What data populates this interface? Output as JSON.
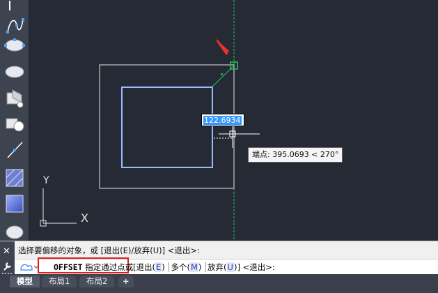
{
  "canvas": {
    "dynamic_input_value": "122.6934",
    "tooltip_text": "端点: 395.0693 < 270°",
    "ucs_y_label": "Y",
    "ucs_x_label": "X"
  },
  "command": {
    "history_line": "选择要偏移的对象，或 [退出(E)/放弃(U)] <退出>:",
    "command_name": "OFFSET",
    "prompt_text": "指定通过点或",
    "options_open": "[",
    "option_exit": "退出",
    "option_exit_key": "E",
    "option_multiple": "多个",
    "option_multiple_key": "M",
    "option_undo": "放弃",
    "option_undo_key": "U",
    "options_close": "]",
    "default_value": "<退出>:"
  },
  "tabs": [
    {
      "label": "模型",
      "active": true
    },
    {
      "label": "布局1",
      "active": false
    },
    {
      "label": "布局2",
      "active": false
    },
    {
      "label": "+",
      "active": false
    }
  ],
  "colors": {
    "canvas_bg": "#262a34",
    "selected_rect": "#7fa7ff",
    "offset_rect": "#e6e6e6",
    "guide_line": "#22c55e",
    "marker_arrow": "#ef3030",
    "highlight_box": "#e02020"
  },
  "palette": [
    "spline-icon",
    "ellipse-icon",
    "ellipse-arc-icon",
    "insert-block-icon",
    "make-block-icon",
    "point-icon",
    "hatch-icon",
    "gradient-icon",
    "region-icon"
  ]
}
